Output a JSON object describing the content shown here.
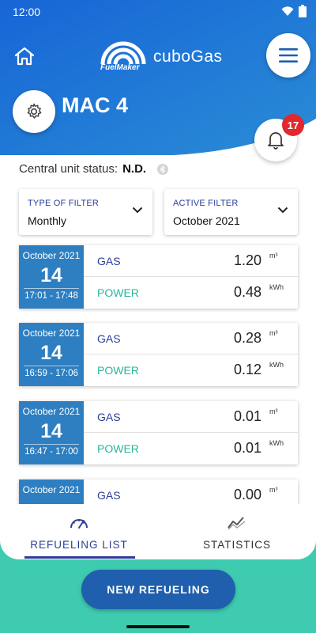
{
  "status_bar": {
    "time": "12:00"
  },
  "header": {
    "logo_text": "FuelMaker",
    "brand": "cuboGas",
    "device_name": "MAC 4",
    "notification_count": "17"
  },
  "central_unit": {
    "label": "Central unit status:",
    "value": "N.D."
  },
  "filters": {
    "type": {
      "label": "TYPE OF FILTER",
      "value": "Monthly"
    },
    "active": {
      "label": "ACTIVE FILTER",
      "value": "October 2021"
    }
  },
  "refuelings": [
    {
      "month": "October 2021",
      "day": "14",
      "range": "17:01 - 17:48",
      "gas_label": "GAS",
      "gas_value": "1.20",
      "gas_unit": "m³",
      "power_label": "POWER",
      "power_value": "0.48",
      "power_unit": "kWh"
    },
    {
      "month": "October 2021",
      "day": "14",
      "range": "16:59 - 17:06",
      "gas_label": "GAS",
      "gas_value": "0.28",
      "gas_unit": "m³",
      "power_label": "POWER",
      "power_value": "0.12",
      "power_unit": "kWh"
    },
    {
      "month": "October 2021",
      "day": "14",
      "range": "16:47 - 17:00",
      "gas_label": "GAS",
      "gas_value": "0.01",
      "gas_unit": "m³",
      "power_label": "POWER",
      "power_value": "0.01",
      "power_unit": "kWh"
    },
    {
      "month": "October 2021",
      "day": "",
      "range": "",
      "gas_label": "GAS",
      "gas_value": "0.00",
      "gas_unit": "m³",
      "power_label": "",
      "power_value": "",
      "power_unit": ""
    }
  ],
  "tabs": [
    {
      "label": "REFUELING LIST",
      "icon": "gauge-icon",
      "active": true
    },
    {
      "label": "STATISTICS",
      "icon": "chart-line-icon",
      "active": false
    }
  ],
  "actions": {
    "new_refueling": "NEW REFUELING"
  },
  "colors": {
    "header_blue": "#1e6fd0",
    "teal": "#3ecbb0",
    "date_blue": "#2e7fc1",
    "gas_text": "#2d3e9a",
    "power_text": "#2bb59a",
    "badge_red": "#e0282e",
    "button_blue": "#1f5fad"
  }
}
